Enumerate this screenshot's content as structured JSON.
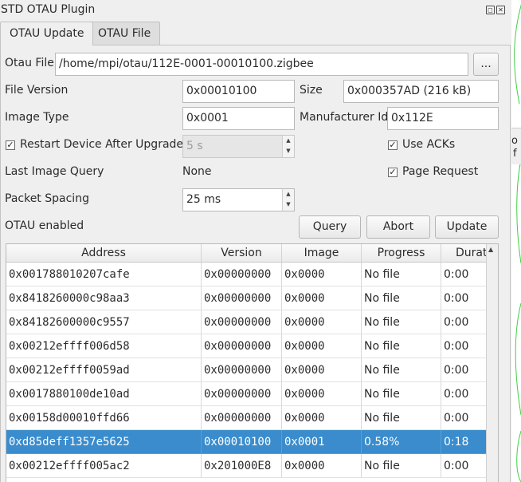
{
  "window": {
    "title": "STD OTAU Plugin"
  },
  "tabs": [
    {
      "label": "OTAU Update",
      "active": true
    },
    {
      "label": "OTAU File",
      "active": false
    }
  ],
  "form": {
    "otau_file_label": "Otau File",
    "otau_file_value": "/home/mpi/otau/112E-0001-00010100.zigbee",
    "browse_label": "...",
    "file_version_label": "File Version",
    "file_version_value": "0x00010100",
    "size_label": "Size",
    "size_value": "0x000357AD (216 kB)",
    "image_type_label": "Image Type",
    "image_type_value": "0x0001",
    "manufacturer_id_label": "Manufacturer Id",
    "manufacturer_id_value": "0x112E",
    "restart_label": "Restart Device After Upgrade",
    "restart_checked": true,
    "restart_delay_value": "5 s",
    "use_acks_label": "Use ACKs",
    "use_acks_checked": true,
    "last_image_query_label": "Last Image Query",
    "last_image_query_value": "None",
    "page_request_label": "Page Request",
    "page_request_checked": true,
    "packet_spacing_label": "Packet Spacing",
    "packet_spacing_value": "25 ms",
    "status_text": "OTAU enabled",
    "query_button": "Query",
    "abort_button": "Abort",
    "update_button": "Update",
    "check_glyph": "✓"
  },
  "table": {
    "columns": [
      "Address",
      "Version",
      "Image",
      "Progress",
      "Durat"
    ],
    "rows": [
      {
        "address": "0x001788010207cafe",
        "version": "0x00000000",
        "image": "0x0000",
        "progress": "No file",
        "duration": "0:00",
        "selected": false
      },
      {
        "address": "0x8418260000c98aa3",
        "version": "0x00000000",
        "image": "0x0000",
        "progress": "No file",
        "duration": "0:00",
        "selected": false
      },
      {
        "address": "0x84182600000c9557",
        "version": "0x00000000",
        "image": "0x0000",
        "progress": "No file",
        "duration": "0:00",
        "selected": false
      },
      {
        "address": "0x00212effff006d58",
        "version": "0x00000000",
        "image": "0x0000",
        "progress": "No file",
        "duration": "0:00",
        "selected": false
      },
      {
        "address": "0x00212effff0059ad",
        "version": "0x00000000",
        "image": "0x0000",
        "progress": "No file",
        "duration": "0:00",
        "selected": false
      },
      {
        "address": "0x0017880100de10ad",
        "version": "0x00000000",
        "image": "0x0000",
        "progress": "No file",
        "duration": "0:00",
        "selected": false
      },
      {
        "address": "0x00158d00010ffd66",
        "version": "0x00000000",
        "image": "0x0000",
        "progress": "No file",
        "duration": "0:00",
        "selected": false
      },
      {
        "address": "0xd85deff1357e5625",
        "version": "0x00010100",
        "image": "0x0001",
        "progress": "0.58%",
        "duration": "0:18",
        "selected": true
      },
      {
        "address": "0x00212effff005ac2",
        "version": "0x201000E8",
        "image": "0x0000",
        "progress": "No file",
        "duration": "0:00",
        "selected": false
      }
    ]
  },
  "colors": {
    "selection": "#3a8ccc",
    "panel_bg": "#efefef",
    "background_curve": "#44cc44"
  },
  "background": {
    "partial_text_1": "o",
    "partial_text_2": "f"
  }
}
